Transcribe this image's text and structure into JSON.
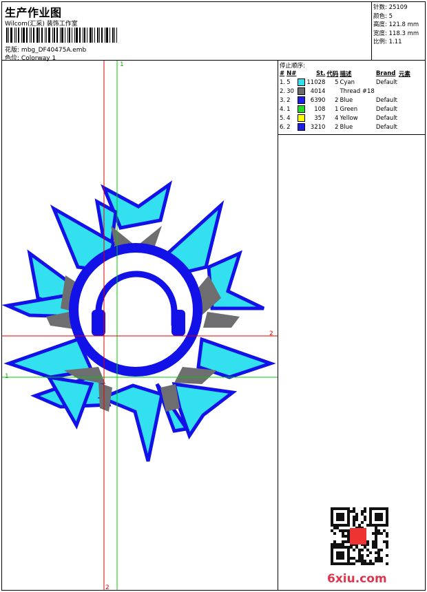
{
  "header": {
    "title": "生产作业图",
    "company": "Wilcom(汇采) 装饰工作室",
    "design_label": "花版:",
    "design_name": "mbg_DF40475A.emb",
    "colorway_label": "色位:",
    "colorway_name": "Colorway 1"
  },
  "stats": [
    {
      "label": "针数:",
      "value": "25109"
    },
    {
      "label": "颜色:",
      "value": "5"
    },
    {
      "label": "高度:",
      "value": "121.8 mm"
    },
    {
      "label": "宽度:",
      "value": "118.3 mm"
    },
    {
      "label": "比例:",
      "value": "1.11"
    }
  ],
  "stop_sequence": {
    "title": "停止顺序:",
    "headers": {
      "num": "#",
      "n": "N#",
      "st": "St.",
      "code": "代码",
      "desc": "描述",
      "brand": "Brand",
      "elem": "元素"
    },
    "rows": [
      {
        "num": "1.",
        "n": "5",
        "color": "#33e0f0",
        "st": "11028",
        "code": "5",
        "desc": "Cyan",
        "brand": "Default"
      },
      {
        "num": "2.",
        "n": "30",
        "color": "#6b6b6b",
        "st": "4014",
        "code": "",
        "desc": "Thread #18",
        "brand": ""
      },
      {
        "num": "3.",
        "n": "2",
        "color": "#1e1ee6",
        "st": "6390",
        "code": "2",
        "desc": "Blue",
        "brand": "Default"
      },
      {
        "num": "4.",
        "n": "1",
        "color": "#22dd22",
        "st": "108",
        "code": "1",
        "desc": "Green",
        "brand": "Default"
      },
      {
        "num": "5.",
        "n": "4",
        "color": "#ffff00",
        "st": "357",
        "code": "4",
        "desc": "Yellow",
        "brand": "Default"
      },
      {
        "num": "6.",
        "n": "2",
        "color": "#1e1ee6",
        "st": "3210",
        "code": "2",
        "desc": "Blue",
        "brand": "Default"
      }
    ]
  },
  "guides": {
    "green_label_top": "1",
    "green_label_left": "1",
    "red_label_right": "2",
    "red_label_bottom": "2"
  },
  "colors": {
    "cyan": "#33e0f0",
    "blue": "#1212e8",
    "gray": "#6e6e70",
    "red": "#e00000",
    "green": "#00cc00"
  },
  "watermark": {
    "text": "6xiu.com"
  }
}
